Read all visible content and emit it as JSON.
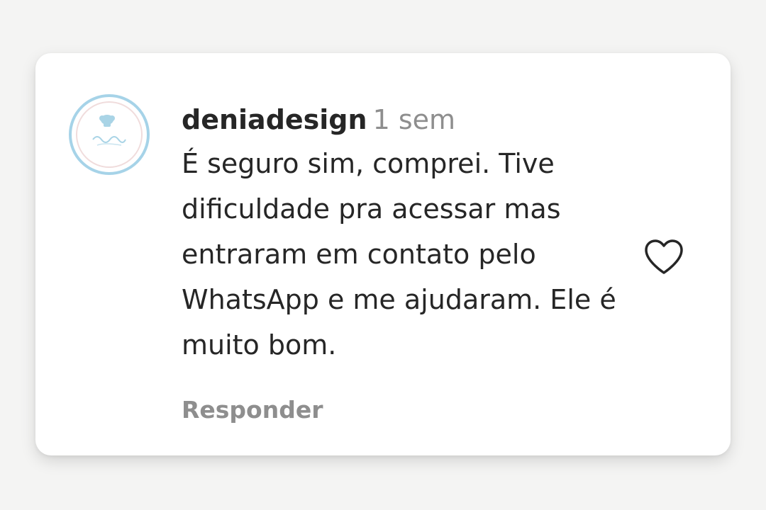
{
  "comment": {
    "username": "deniadesign",
    "timestamp": "1 sem",
    "text": "É seguro sim, comprei. Tive dificuldade pra acessar mas entraram em contato pelo WhatsApp e me ajudaram. Ele é muito bom.",
    "reply_label": "Responder",
    "like_icon": "heart-outline-icon",
    "avatar_border_color": "#a6d3e8"
  }
}
